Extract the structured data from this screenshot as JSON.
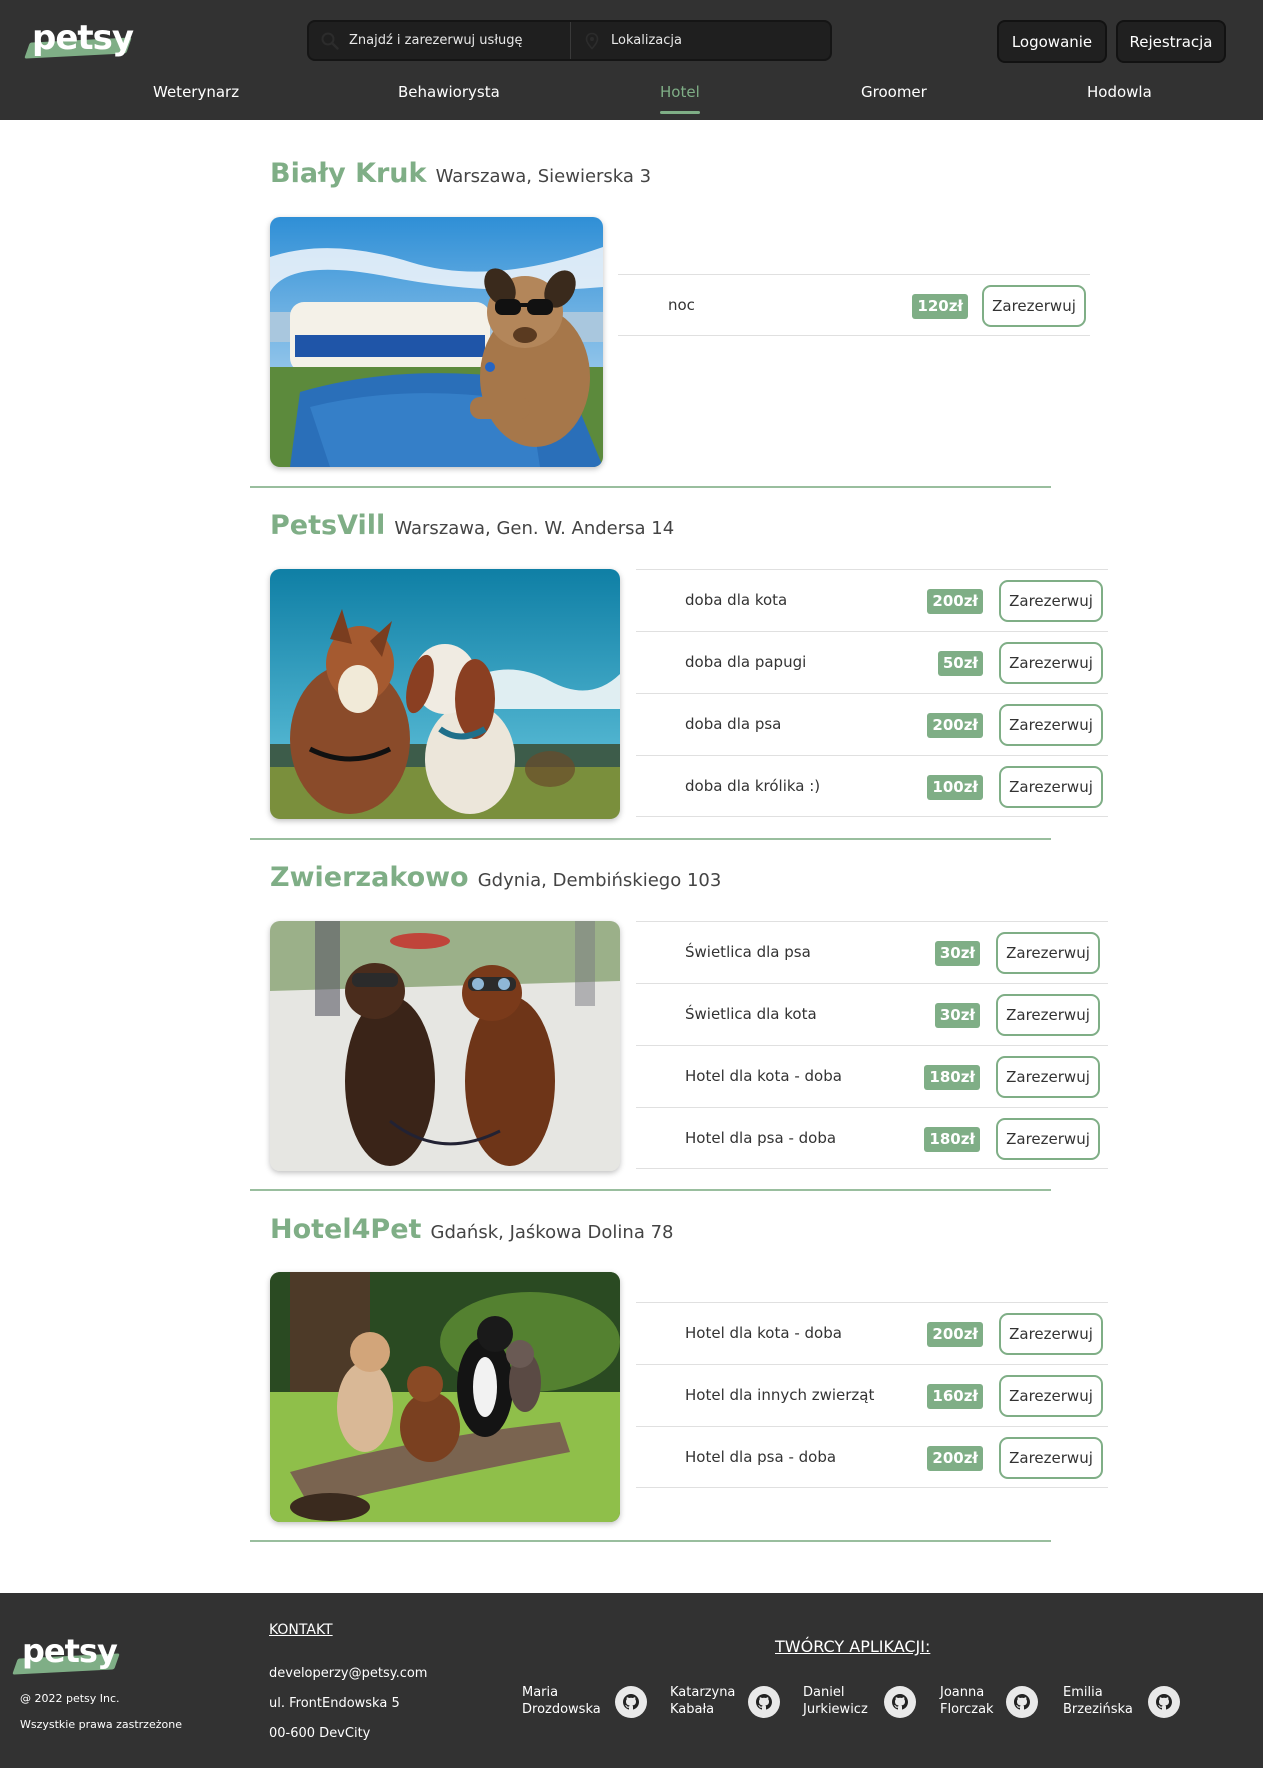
{
  "header": {
    "logo": "petsy",
    "search": {
      "service_placeholder": "Znajdź i zarezerwuj usługę",
      "location_placeholder": "Lokalizacja"
    },
    "login_label": "Logowanie",
    "register_label": "Rejestracja",
    "nav": [
      {
        "label": "Weterynarz",
        "active": false
      },
      {
        "label": "Behawiorysta",
        "active": false
      },
      {
        "label": "Hotel",
        "active": true
      },
      {
        "label": "Groomer",
        "active": false
      },
      {
        "label": "Hodowla",
        "active": false
      }
    ]
  },
  "colors": {
    "accent": "#7fae86",
    "header_bg": "#323232",
    "footer_bg": "#323232"
  },
  "listings": [
    {
      "name": "Biały Kruk",
      "address": "Warszawa, Siewierska 3",
      "image": "dog-with-sunglasses-on-boat",
      "offers": [
        {
          "name": "noc",
          "price": "120zł",
          "action": "Zarezerwuj"
        }
      ]
    },
    {
      "name": "PetsVill",
      "address": "Warszawa, Gen. W. Andersa 14",
      "image": "two-dogs-looking-up-sky",
      "offers": [
        {
          "name": "doba dla kota",
          "price": "200zł",
          "action": "Zarezerwuj"
        },
        {
          "name": "doba dla papugi",
          "price": "50zł",
          "action": "Zarezerwuj"
        },
        {
          "name": "doba dla psa",
          "price": "200zł",
          "action": "Zarezerwuj"
        },
        {
          "name": "doba dla królika :)",
          "price": "100zł",
          "action": "Zarezerwuj"
        }
      ]
    },
    {
      "name": "Zwierzakowo",
      "address": "Gdynia, Dembińskiego 103",
      "image": "two-poodles-with-goggles",
      "offers": [
        {
          "name": "Świetlica dla psa",
          "price": "30zł",
          "action": "Zarezerwuj"
        },
        {
          "name": "Świetlica dla kota",
          "price": "30zł",
          "action": "Zarezerwuj"
        },
        {
          "name": "Hotel dla kota - doba",
          "price": "180zł",
          "action": "Zarezerwuj"
        },
        {
          "name": "Hotel dla psa - doba",
          "price": "180zł",
          "action": "Zarezerwuj"
        }
      ]
    },
    {
      "name": "Hotel4Pet",
      "address": "Gdańsk, Jaśkowa Dolina 78",
      "image": "four-dogs-on-log-in-park",
      "offers": [
        {
          "name": "Hotel dla kota - doba",
          "price": "200zł",
          "action": "Zarezerwuj"
        },
        {
          "name": "Hotel dla innych zwierząt",
          "price": "160zł",
          "action": "Zarezerwuj"
        },
        {
          "name": "Hotel dla psa - doba",
          "price": "200zł",
          "action": "Zarezerwuj"
        }
      ]
    }
  ],
  "footer": {
    "logo": "petsy",
    "copyright": "@ 2022 petsy Inc.",
    "rights": "Wszystkie prawa zastrzeżone",
    "contact_heading": "KONTAKT",
    "contact_email": "developerzy@petsy.com",
    "contact_street": "ul. FrontEndowska 5",
    "contact_city": "00-600 DevCity",
    "authors_heading": "TWÓRCY APLIKACJI:",
    "authors": [
      {
        "first": "Maria",
        "last": "Drozdowska",
        "icon": "github-icon"
      },
      {
        "first": "Katarzyna",
        "last": "Kabała",
        "icon": "github-icon"
      },
      {
        "first": "Daniel",
        "last": "Jurkiewicz",
        "icon": "github-icon"
      },
      {
        "first": "Joanna",
        "last": "Florczak",
        "icon": "github-icon"
      },
      {
        "first": "Emilia",
        "last": "Brzezińska",
        "icon": "github-icon"
      }
    ]
  }
}
